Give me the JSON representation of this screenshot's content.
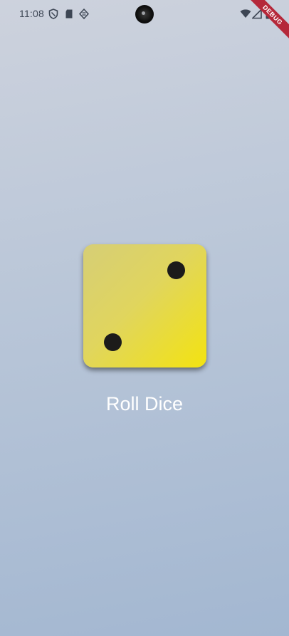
{
  "status_bar": {
    "time": "11:08",
    "left_icons": [
      "shield-icon",
      "sd-card-icon",
      "cast-icon"
    ],
    "right_icons": [
      "wifi-icon",
      "signal-icon",
      "battery-icon"
    ]
  },
  "debug_banner": {
    "label": "DEBUG",
    "color": "#b5283a"
  },
  "dice": {
    "value": 2,
    "face_color_start": "#d6ce76",
    "face_color_end": "#f3e310",
    "pip_color": "#1c1b1a"
  },
  "roll_button": {
    "label": "Roll Dice"
  },
  "background": {
    "top_color": "#cdd2dd",
    "bottom_color": "#a3b7d1"
  }
}
